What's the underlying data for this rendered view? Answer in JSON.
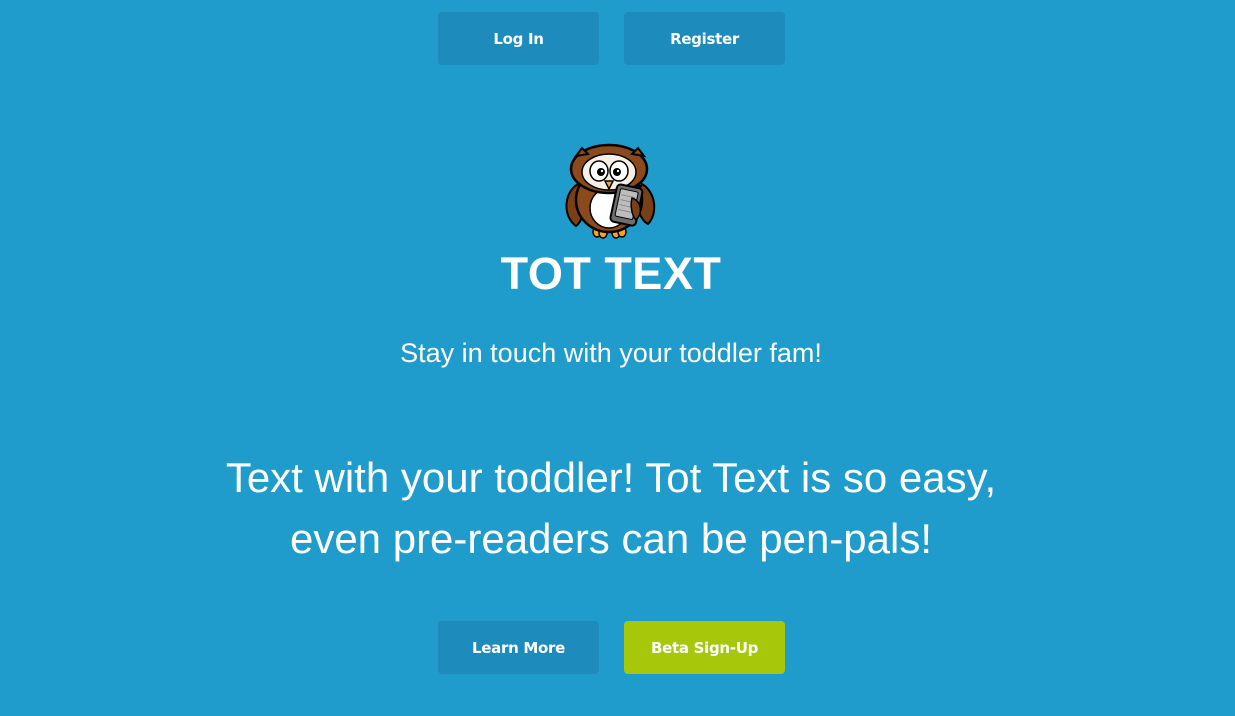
{
  "nav": {
    "login_label": "Log In",
    "register_label": "Register"
  },
  "hero": {
    "logo_icon": "owl-with-tablet-icon",
    "title": "TOT TEXT",
    "tagline": "Stay in touch with your toddler fam!",
    "lead_line1": "Text with your toddler! Tot Text is so easy,",
    "lead_line2": "even pre-readers can be pen-pals!"
  },
  "cta": {
    "learn_more_label": "Learn More",
    "beta_signup_label": "Beta Sign-Up"
  },
  "colors": {
    "background": "#209ccc",
    "button": "#1d8bbb",
    "accent_green": "#a7c80a",
    "text": "#ffffff"
  }
}
